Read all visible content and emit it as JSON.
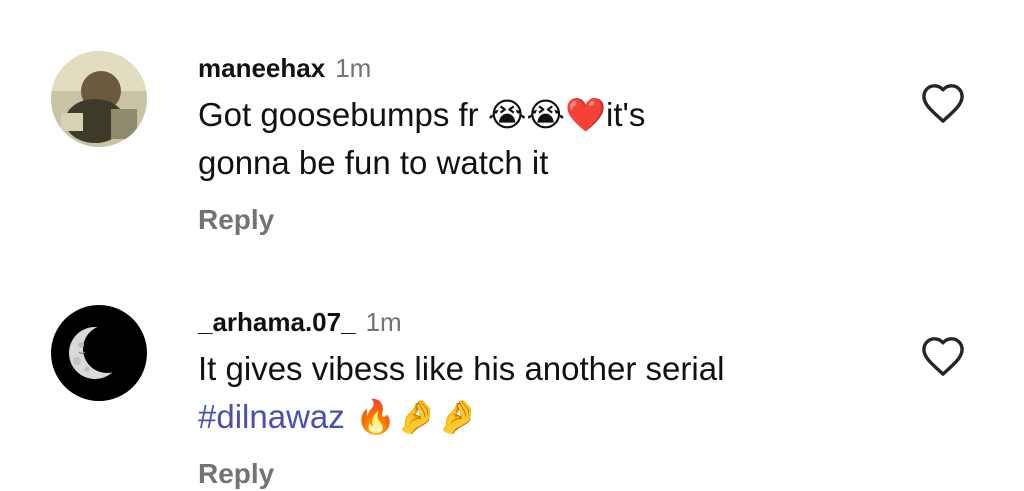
{
  "comments": [
    {
      "username": "maneehax",
      "time": "1m",
      "text_line1": "Got goosebumps fr ",
      "emoji1": "😭😭❤️",
      "text_line1b": "it's",
      "text_line2": "gonna be fun to watch it",
      "reply_label": "Reply"
    },
    {
      "username": "_arhama.07_",
      "time": "1m",
      "text_line1": "It gives vibess like his another serial",
      "hashtag": "#dilnawaz",
      "emoji2": " 🔥🤌🤌",
      "reply_label": "Reply"
    }
  ],
  "icons": {
    "like": "heart-outline-icon"
  },
  "colors": {
    "username": "#111111",
    "meta_gray": "#737373",
    "hashtag": "#4a4fb0"
  }
}
